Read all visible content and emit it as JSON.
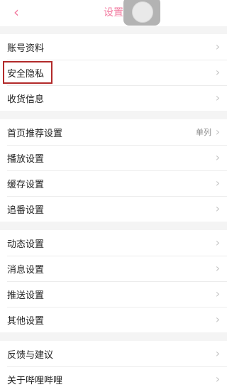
{
  "header": {
    "title": "设置",
    "back_icon": "chevron-left-icon"
  },
  "groups": [
    {
      "items": [
        {
          "label": "账号资料"
        },
        {
          "label": "安全隐私"
        },
        {
          "label": "收货信息"
        }
      ]
    },
    {
      "items": [
        {
          "label": "首页推荐设置",
          "value": "单列"
        },
        {
          "label": "播放设置"
        },
        {
          "label": "缓存设置"
        },
        {
          "label": "追番设置"
        }
      ]
    },
    {
      "items": [
        {
          "label": "动态设置"
        },
        {
          "label": "消息设置"
        },
        {
          "label": "推送设置"
        },
        {
          "label": "其他设置"
        }
      ]
    },
    {
      "items": [
        {
          "label": "反馈与建议"
        },
        {
          "label": "关于哔哩哔哩"
        }
      ]
    }
  ],
  "colors": {
    "accent": "#f27ba0",
    "highlight_border": "#b22a2a",
    "background": "#f4f4f4"
  }
}
